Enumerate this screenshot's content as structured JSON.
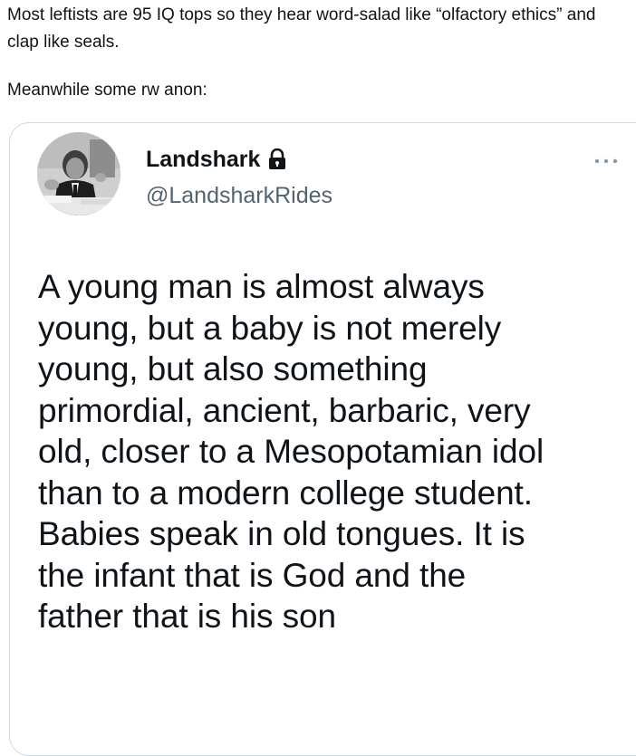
{
  "post": {
    "text_line1": "Most leftists are 95 IQ tops so they hear word-salad like “olfactory ethics” and clap like seals.",
    "text_line2": "Meanwhile some rw anon:"
  },
  "quoted_tweet": {
    "display_name": "Landshark",
    "handle": "@LandsharkRides",
    "protected_icon": "lock-icon",
    "more_icon": "more-horizontal-icon",
    "body": "A young man is almost always\nyoung, but a baby is not merely\nyoung, but also something\nprimordial, ancient, barbaric, very\nold, closer to a Mesopotamian idol\nthan to a modern college student.\nBabies speak in old tongues. It is\nthe infant that is God and the\nfather that is his son"
  }
}
